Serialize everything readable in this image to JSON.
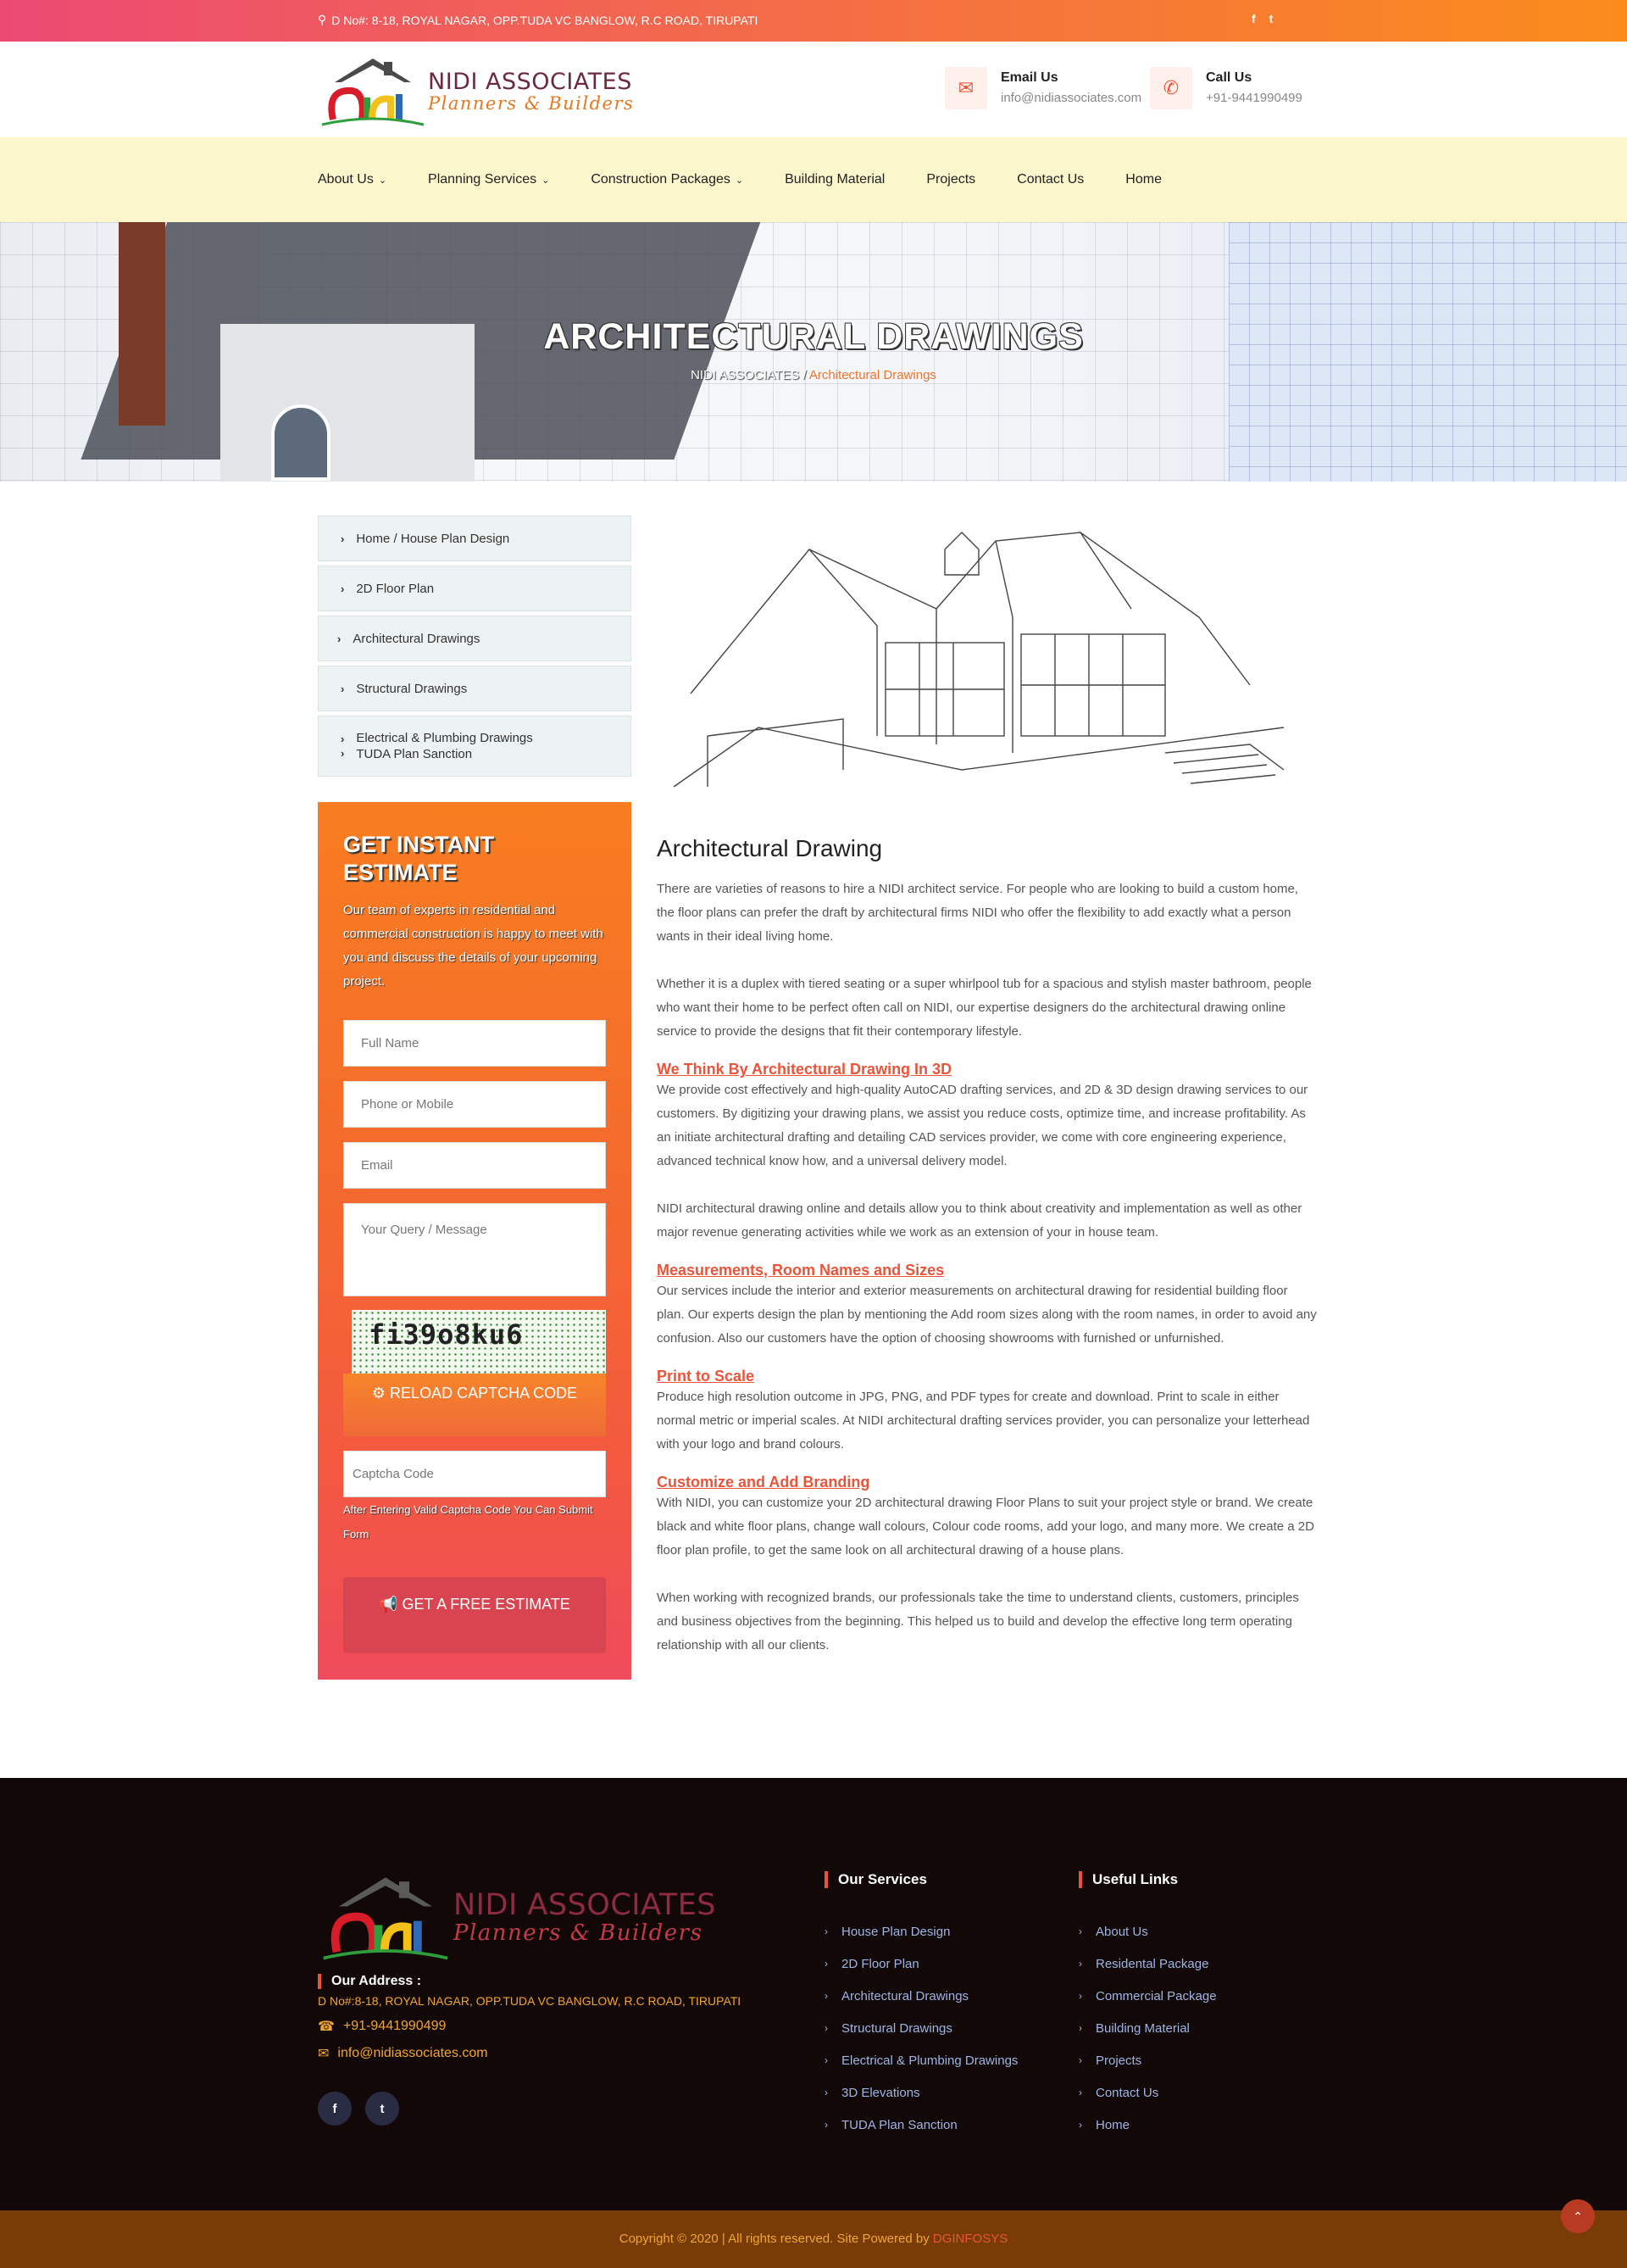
{
  "topbar": {
    "address": "D No#: 8-18, ROYAL NAGAR, OPP.TUDA VC BANGLOW, R.C ROAD, TIRUPATI",
    "social": [
      "f",
      "t"
    ]
  },
  "brand": {
    "name": "NIDI ASSOCIATES",
    "tagline": "Planners & Builders",
    "logo_letters": "Nidi"
  },
  "header": {
    "email_label": "Email Us",
    "email_value": "info@nidiassociates.com",
    "call_label": "Call Us",
    "call_value": "+91-9441990499"
  },
  "nav": {
    "items": [
      {
        "label": "About Us",
        "dropdown": true
      },
      {
        "label": "Planning Services",
        "dropdown": true
      },
      {
        "label": "Construction Packages",
        "dropdown": true
      },
      {
        "label": "Building Material",
        "dropdown": false
      },
      {
        "label": "Projects",
        "dropdown": false
      },
      {
        "label": "Contact Us",
        "dropdown": false
      },
      {
        "label": "Home",
        "dropdown": false
      }
    ]
  },
  "hero": {
    "title": "ARCHITECTURAL DRAWINGS",
    "crumb_home": "NIDI ASSOCIATES",
    "crumb_sep": "/",
    "crumb_current": "Architectural Drawings"
  },
  "sidebar": {
    "items": [
      "Home / House Plan Design",
      "2D Floor Plan",
      "Architectural Drawings",
      "Structural Drawings"
    ],
    "last_item": [
      "Electrical & Plumbing Drawings",
      "TUDA Plan Sanction"
    ]
  },
  "estimate": {
    "title": "GET INSTANT ESTIMATE",
    "intro": "Our team of experts in residential and commercial construction is happy to meet with you and discuss the details of your upcoming project.",
    "name_placeholder": "Full Name",
    "phone_placeholder": "Phone  or Mobile",
    "email_placeholder": "Email",
    "message_placeholder": "Your Query / Message",
    "captcha_text": "fi39o8ku6",
    "reload_label": "RELOAD CAPTCHA CODE",
    "captcha_placeholder": "Captcha Code",
    "note": "After Entering Valid Captcha Code You Can Submit Form",
    "submit_label": "GET A FREE ESTIMATE"
  },
  "content": {
    "heading": "Architectural Drawing",
    "p1": "There are varieties of reasons to hire a NIDI architect service. For people who are looking to build a custom home, the floor plans can prefer the draft by architectural firms NIDI who offer the flexibility to add exactly what a person wants in their ideal living home.",
    "p2": "Whether it is a duplex with tiered seating or a super whirlpool tub for a spacious and stylish master bathroom, people who want their home to be perfect often call on NIDI, our expertise designers do the architectural drawing online service to provide the designs that fit their contemporary lifestyle.",
    "h_think": "We Think By Architectural Drawing In 3D",
    "p3": "We provide cost effectively and high-quality AutoCAD drafting services, and 2D & 3D design drawing services to our customers. By digitizing your drawing plans, we assist you reduce costs, optimize time, and increase profitability. As an initiate architectural drafting and detailing CAD services provider, we come with core engineering experience, advanced technical know how, and a universal delivery model.",
    "p4": "NIDI architectural drawing online and details allow you to think about creativity and implementation as well as other major revenue generating activities while we work as an extension of your in house team.",
    "h_measure": "Measurements, Room Names and Sizes",
    "p5": "Our services include the interior and exterior measurements on architectural drawing for residential building floor plan. Our experts design the plan by mentioning the Add room sizes along with the room names, in order to avoid any confusion. Also our customers have the option of choosing showrooms with furnished or unfurnished.",
    "h_print": "Print to Scale",
    "p6": "Produce high resolution outcome in JPG, PNG, and PDF types for create and download. Print to scale in either normal metric or imperial scales. At NIDI architectural drafting services provider, you can personalize your letterhead with your logo and brand colours.",
    "h_custom": "Customize and Add Branding",
    "p7": "With NIDI, you can customize your 2D architectural drawing Floor Plans to suit your project style or brand. We create black and white floor plans, change wall colours, Colour code rooms, add your logo, and many more. We create a 2D floor plan profile, to get the same look on all architectural drawing of a house plans.",
    "p8": "When working with recognized brands, our professionals take the time to understand clients, customers, principles and business objectives from the beginning. This helped us to build and develop the effective long term operating relationship with all our clients."
  },
  "footer": {
    "address_heading": "Our Address :",
    "address": "D No#:8-18, ROYAL NAGAR, OPP.TUDA VC BANGLOW, R.C ROAD, TIRUPATI",
    "phone": "+91-9441990499",
    "email": "info@nidiassociates.com",
    "services_heading": "Our Services",
    "services": [
      "House Plan Design",
      "2D Floor Plan",
      "Architectural Drawings",
      "Structural Drawings",
      "Electrical & Plumbing Drawings",
      "3D Elevations",
      "TUDA Plan Sanction"
    ],
    "links_heading": "Useful Links",
    "links": [
      "About Us",
      "Residental Package",
      "Commercial Package",
      "Building Material",
      "Projects",
      "Contact Us",
      "Home"
    ],
    "copyright": "Copyright © 2020 | All rights reserved. Site Powered by ",
    "powered_by": "DGINFOSYS"
  },
  "colors": {
    "accent": "#e9543a",
    "gold": "#f1a531",
    "nav_bg": "#fcf6cd",
    "footer_bg": "#120807"
  }
}
